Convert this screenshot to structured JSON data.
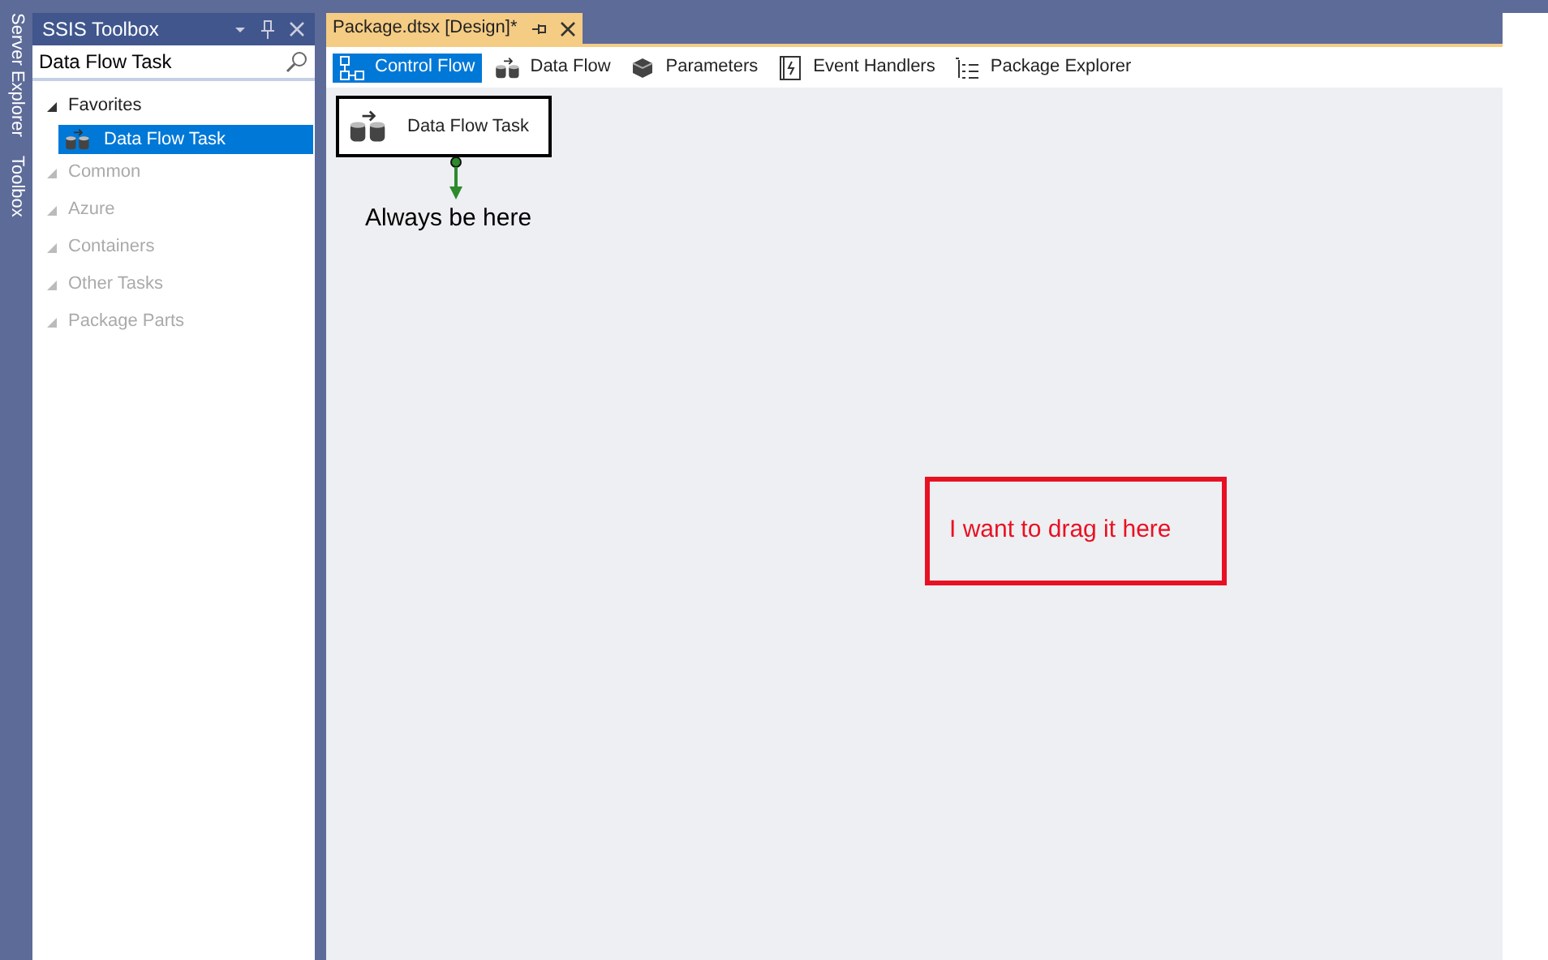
{
  "side_tabs": [
    "Server Explorer",
    "Toolbox"
  ],
  "toolbox": {
    "title": "SSIS Toolbox",
    "search": {
      "value": "Data Flow Task"
    },
    "groups": [
      {
        "label": "Favorites",
        "expanded": true,
        "disabled": false,
        "children": [
          {
            "label": "Data Flow Task",
            "selected": true
          }
        ]
      },
      {
        "label": "Common",
        "expanded": true,
        "disabled": true
      },
      {
        "label": "Azure",
        "expanded": true,
        "disabled": true
      },
      {
        "label": "Containers",
        "expanded": true,
        "disabled": true
      },
      {
        "label": "Other Tasks",
        "expanded": true,
        "disabled": true
      },
      {
        "label": "Package Parts",
        "expanded": true,
        "disabled": true
      }
    ]
  },
  "document_tab": {
    "title": "Package.dtsx [Design]*"
  },
  "designer_tabs": [
    {
      "label": "Control Flow",
      "kind": "control",
      "selected": true
    },
    {
      "label": "Data Flow",
      "kind": "dataflow",
      "selected": false
    },
    {
      "label": "Parameters",
      "kind": "params",
      "selected": false
    },
    {
      "label": "Event Handlers",
      "kind": "events",
      "selected": false
    },
    {
      "label": "Package Explorer",
      "kind": "explorer",
      "selected": false
    }
  ],
  "canvas": {
    "task": {
      "label": "Data Flow Task"
    },
    "annotations": [
      {
        "text": "Always be here",
        "kind": "plain"
      },
      {
        "text": "I want to drag it here",
        "kind": "boxed"
      }
    ]
  }
}
